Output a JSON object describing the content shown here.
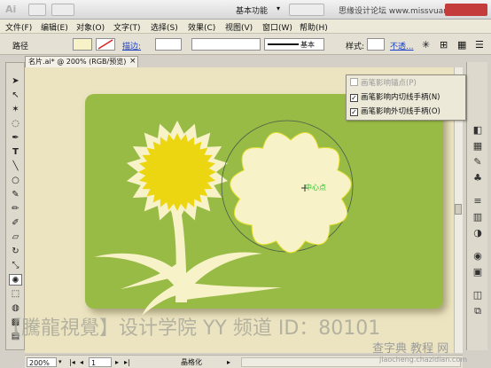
{
  "titlebar": {
    "app_logo": "Ai",
    "workspace": "基本功能",
    "watermark": "思缘设计论坛 www.missvuan.com"
  },
  "menu": [
    "文件(F)",
    "编辑(E)",
    "对象(O)",
    "文字(T)",
    "选择(S)",
    "效果(C)",
    "视图(V)",
    "窗口(W)",
    "帮助(H)"
  ],
  "controlbar": {
    "object_type": "路径",
    "stroke_label": "描边:",
    "stroke_style": "基本",
    "style_label": "样式:",
    "opacity_label": "不透..."
  },
  "document": {
    "tab_title": "名片.ai* @ 200% (RGB/预览)",
    "close": "×"
  },
  "canvas": {
    "center_label": "中心点",
    "card_color": "#98bb44",
    "flower_petal_color": "#f7f2c8",
    "sun_color": "#ecd511"
  },
  "popup": {
    "items": [
      {
        "label": "画笔影响锚点(P)",
        "checked": false,
        "disabled": true
      },
      {
        "label": "画笔影响内切线手柄(N)",
        "checked": true,
        "disabled": false
      },
      {
        "label": "画笔影响外切线手柄(O)",
        "checked": true,
        "disabled": false
      }
    ]
  },
  "status": {
    "zoom": "200%",
    "page": "1",
    "tool_name": "晶格化"
  },
  "watermark": {
    "bottom": "【騰龍視覺】设计学院  YY 频道 ID：80101",
    "brand": "查字典 教程 网",
    "url": "jiaocheng.chazidian.com"
  }
}
